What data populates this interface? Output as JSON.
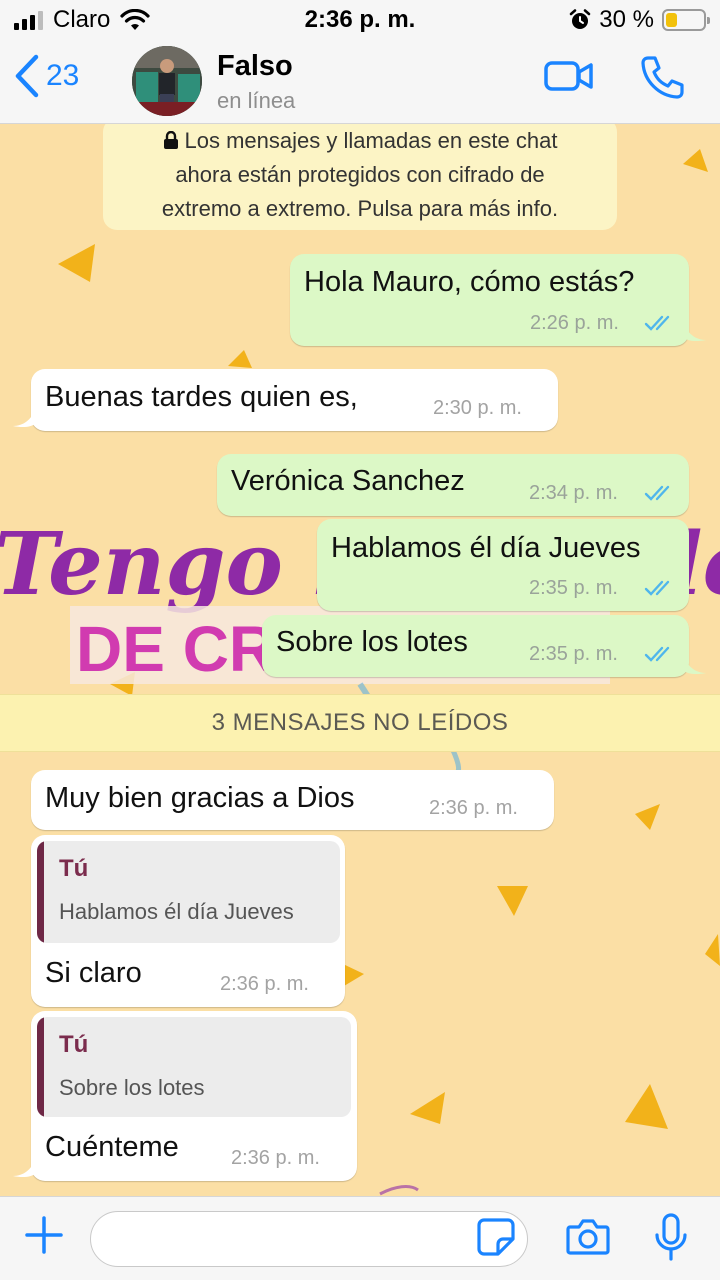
{
  "status_bar": {
    "carrier": "Claro",
    "time": "2:36 p. m.",
    "battery": "30 %"
  },
  "header": {
    "back_count": "23",
    "contact_name": "Falso",
    "contact_status": "en línea"
  },
  "encryption_notice": {
    "line1": "Los mensajes y llamadas en este chat",
    "line2": "ahora están protegidos con cifrado de",
    "line3": "extremo a extremo. Pulsa para más info."
  },
  "messages": [
    {
      "direction": "out",
      "text": "Hola Mauro, cómo estás?",
      "time": "2:26 p. m."
    },
    {
      "direction": "in",
      "text": "Buenas tardes quien es,",
      "time": "2:30 p. m."
    },
    {
      "direction": "out",
      "text": "Verónica Sanchez",
      "time": "2:34 p. m."
    },
    {
      "direction": "out",
      "text": "Hablamos él día Jueves",
      "time": "2:35 p. m."
    },
    {
      "direction": "out",
      "text": "Sobre los lotes",
      "time": "2:35 p. m."
    },
    {
      "direction": "in",
      "text": "Muy bien gracias a Dios",
      "time": "2:36 p. m."
    },
    {
      "direction": "in",
      "text": "Si claro",
      "time": "2:36 p. m.",
      "quote_author": "Tú",
      "quote_text": "Hablamos él día Jueves"
    },
    {
      "direction": "in",
      "text": "Cuénteme",
      "time": "2:36 p. m.",
      "quote_author": "Tú",
      "quote_text": "Sobre los lotes"
    }
  ],
  "unread_banner": "3 MENSAJES NO LEÍDOS",
  "wallpaper_text": {
    "line1": "Tengo la lib",
    "line1_end": "le",
    "line2": "DE CREA"
  },
  "input": {
    "placeholder": ""
  },
  "colors": {
    "accent": "#1a84ff",
    "outgoing": "#dcf8c6",
    "incoming": "#ffffff",
    "wallpaper": "#fbdfa5",
    "read_ticks": "#4fb6ec"
  },
  "icons": [
    "chevron-left-icon",
    "video-camera-icon",
    "phone-icon",
    "lock-icon",
    "double-check-icon",
    "plus-icon",
    "sticker-icon",
    "camera-icon",
    "microphone-icon"
  ]
}
